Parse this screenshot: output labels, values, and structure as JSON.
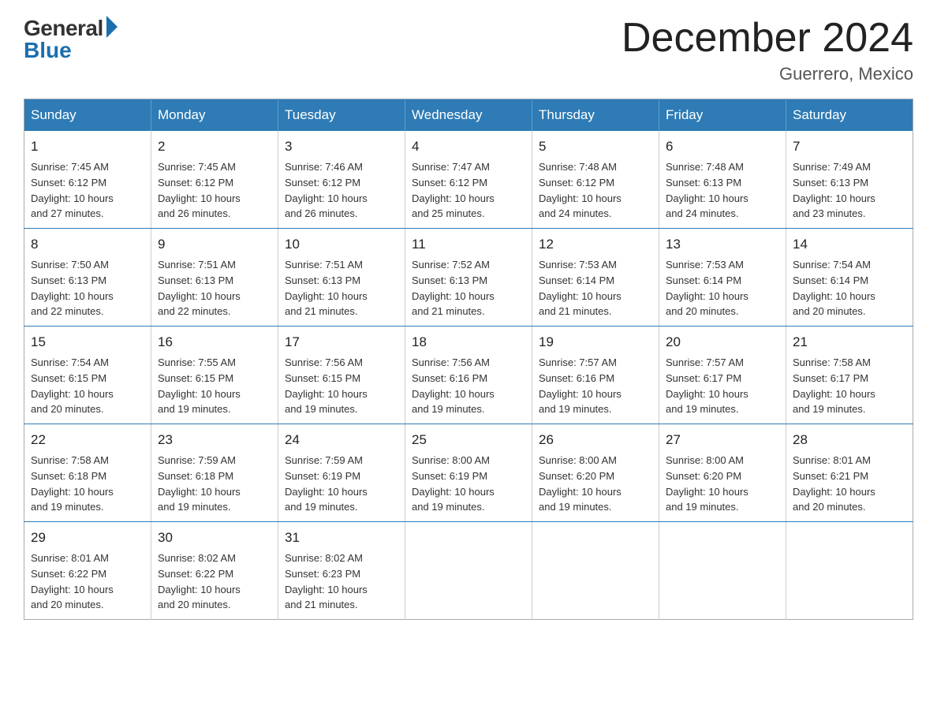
{
  "logo": {
    "general": "General",
    "blue": "Blue"
  },
  "title": "December 2024",
  "location": "Guerrero, Mexico",
  "days_of_week": [
    "Sunday",
    "Monday",
    "Tuesday",
    "Wednesday",
    "Thursday",
    "Friday",
    "Saturday"
  ],
  "weeks": [
    [
      {
        "day": "1",
        "sunrise": "7:45 AM",
        "sunset": "6:12 PM",
        "daylight": "10 hours and 27 minutes."
      },
      {
        "day": "2",
        "sunrise": "7:45 AM",
        "sunset": "6:12 PM",
        "daylight": "10 hours and 26 minutes."
      },
      {
        "day": "3",
        "sunrise": "7:46 AM",
        "sunset": "6:12 PM",
        "daylight": "10 hours and 26 minutes."
      },
      {
        "day": "4",
        "sunrise": "7:47 AM",
        "sunset": "6:12 PM",
        "daylight": "10 hours and 25 minutes."
      },
      {
        "day": "5",
        "sunrise": "7:48 AM",
        "sunset": "6:12 PM",
        "daylight": "10 hours and 24 minutes."
      },
      {
        "day": "6",
        "sunrise": "7:48 AM",
        "sunset": "6:13 PM",
        "daylight": "10 hours and 24 minutes."
      },
      {
        "day": "7",
        "sunrise": "7:49 AM",
        "sunset": "6:13 PM",
        "daylight": "10 hours and 23 minutes."
      }
    ],
    [
      {
        "day": "8",
        "sunrise": "7:50 AM",
        "sunset": "6:13 PM",
        "daylight": "10 hours and 22 minutes."
      },
      {
        "day": "9",
        "sunrise": "7:51 AM",
        "sunset": "6:13 PM",
        "daylight": "10 hours and 22 minutes."
      },
      {
        "day": "10",
        "sunrise": "7:51 AM",
        "sunset": "6:13 PM",
        "daylight": "10 hours and 21 minutes."
      },
      {
        "day": "11",
        "sunrise": "7:52 AM",
        "sunset": "6:13 PM",
        "daylight": "10 hours and 21 minutes."
      },
      {
        "day": "12",
        "sunrise": "7:53 AM",
        "sunset": "6:14 PM",
        "daylight": "10 hours and 21 minutes."
      },
      {
        "day": "13",
        "sunrise": "7:53 AM",
        "sunset": "6:14 PM",
        "daylight": "10 hours and 20 minutes."
      },
      {
        "day": "14",
        "sunrise": "7:54 AM",
        "sunset": "6:14 PM",
        "daylight": "10 hours and 20 minutes."
      }
    ],
    [
      {
        "day": "15",
        "sunrise": "7:54 AM",
        "sunset": "6:15 PM",
        "daylight": "10 hours and 20 minutes."
      },
      {
        "day": "16",
        "sunrise": "7:55 AM",
        "sunset": "6:15 PM",
        "daylight": "10 hours and 19 minutes."
      },
      {
        "day": "17",
        "sunrise": "7:56 AM",
        "sunset": "6:15 PM",
        "daylight": "10 hours and 19 minutes."
      },
      {
        "day": "18",
        "sunrise": "7:56 AM",
        "sunset": "6:16 PM",
        "daylight": "10 hours and 19 minutes."
      },
      {
        "day": "19",
        "sunrise": "7:57 AM",
        "sunset": "6:16 PM",
        "daylight": "10 hours and 19 minutes."
      },
      {
        "day": "20",
        "sunrise": "7:57 AM",
        "sunset": "6:17 PM",
        "daylight": "10 hours and 19 minutes."
      },
      {
        "day": "21",
        "sunrise": "7:58 AM",
        "sunset": "6:17 PM",
        "daylight": "10 hours and 19 minutes."
      }
    ],
    [
      {
        "day": "22",
        "sunrise": "7:58 AM",
        "sunset": "6:18 PM",
        "daylight": "10 hours and 19 minutes."
      },
      {
        "day": "23",
        "sunrise": "7:59 AM",
        "sunset": "6:18 PM",
        "daylight": "10 hours and 19 minutes."
      },
      {
        "day": "24",
        "sunrise": "7:59 AM",
        "sunset": "6:19 PM",
        "daylight": "10 hours and 19 minutes."
      },
      {
        "day": "25",
        "sunrise": "8:00 AM",
        "sunset": "6:19 PM",
        "daylight": "10 hours and 19 minutes."
      },
      {
        "day": "26",
        "sunrise": "8:00 AM",
        "sunset": "6:20 PM",
        "daylight": "10 hours and 19 minutes."
      },
      {
        "day": "27",
        "sunrise": "8:00 AM",
        "sunset": "6:20 PM",
        "daylight": "10 hours and 19 minutes."
      },
      {
        "day": "28",
        "sunrise": "8:01 AM",
        "sunset": "6:21 PM",
        "daylight": "10 hours and 20 minutes."
      }
    ],
    [
      {
        "day": "29",
        "sunrise": "8:01 AM",
        "sunset": "6:22 PM",
        "daylight": "10 hours and 20 minutes."
      },
      {
        "day": "30",
        "sunrise": "8:02 AM",
        "sunset": "6:22 PM",
        "daylight": "10 hours and 20 minutes."
      },
      {
        "day": "31",
        "sunrise": "8:02 AM",
        "sunset": "6:23 PM",
        "daylight": "10 hours and 21 minutes."
      },
      null,
      null,
      null,
      null
    ]
  ],
  "labels": {
    "sunrise": "Sunrise:",
    "sunset": "Sunset:",
    "daylight": "Daylight:"
  }
}
